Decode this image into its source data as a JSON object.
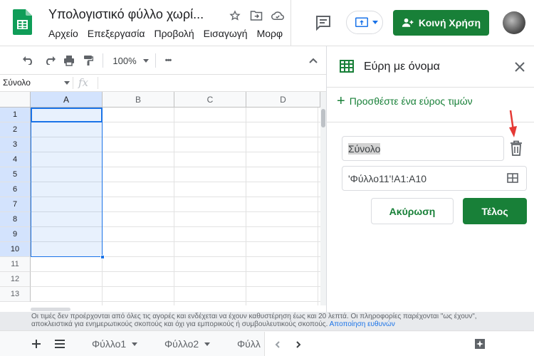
{
  "header": {
    "title": "Υπολογιστικό φύλλο χωρί...",
    "menu": [
      "Αρχείο",
      "Επεξεργασία",
      "Προβολή",
      "Εισαγωγή",
      "Μορφ"
    ],
    "share_label": "Κοινή Χρήση"
  },
  "toolbar": {
    "zoom": "100%",
    "more": "•••"
  },
  "formula_bar": {
    "name_box": "Σύνολο",
    "fx": "fx"
  },
  "grid": {
    "columns": [
      "A",
      "B",
      "C",
      "D"
    ],
    "rows": [
      "1",
      "2",
      "3",
      "4",
      "5",
      "6",
      "7",
      "8",
      "9",
      "10",
      "11",
      "12",
      "13"
    ],
    "selected_column": "A",
    "selected_rows": [
      "1",
      "2",
      "3",
      "4",
      "5",
      "6",
      "7",
      "8",
      "9",
      "10"
    ]
  },
  "disclaimer": {
    "text": "Οι τιμές δεν προέρχονται από όλες τις αγορές και ενδέχεται να έχουν καθυστέρηση έως και 20 λεπτά. Οι πληροφορίες παρέχονται \"ως έχουν\", αποκλειστικά για ενημερωτικούς σκοπούς και όχι για εμπορικούς ή συμβουλευτικούς σκοπούς.",
    "link": "Αποποίηση ευθυνών"
  },
  "sheets": {
    "tabs": [
      "Φύλλο1",
      "Φύλλο2",
      "Φύλλ"
    ]
  },
  "panel": {
    "title": "Εύρη με όνομα",
    "add_range": "Προσθέστε ένα εύρος τιμών",
    "name_value": "Σύνολο",
    "range_value": "'Φύλλο11'!A1:A10",
    "cancel_label": "Ακύρωση",
    "done_label": "Τέλος"
  },
  "colors": {
    "accent": "#188038",
    "selection": "#1a73e8",
    "annotation_arrow": "#e53935"
  },
  "icons": [
    "sheets-logo",
    "star-icon",
    "move-folder-icon",
    "cloud-status-icon",
    "comment-icon",
    "present-icon",
    "share-person-icon",
    "undo-icon",
    "redo-icon",
    "print-icon",
    "paint-format-icon",
    "collapse-icon",
    "dropdown-icon",
    "named-ranges-icon",
    "close-icon",
    "plus-icon",
    "trash-icon",
    "range-select-icon",
    "add-sheet-icon",
    "all-sheets-icon",
    "explore-icon"
  ]
}
